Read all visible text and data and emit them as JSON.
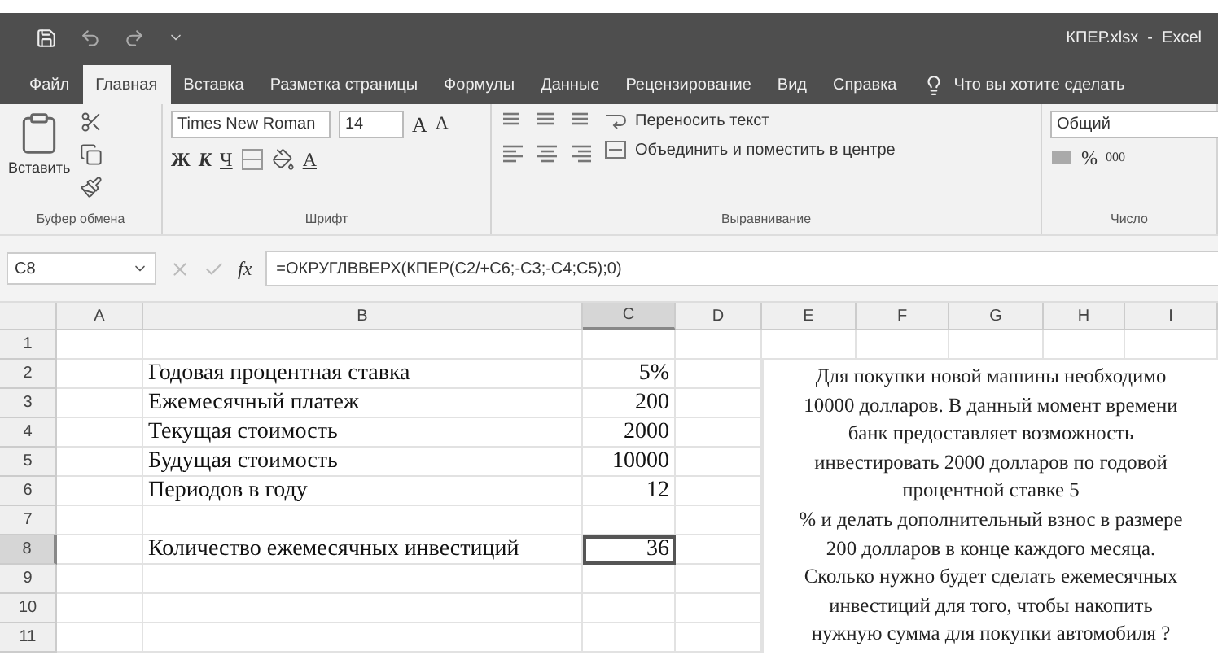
{
  "window": {
    "title": "КПЕР.xlsx  -  Excel"
  },
  "tabs": [
    {
      "label": "Файл",
      "selected": false
    },
    {
      "label": "Главная",
      "selected": true
    },
    {
      "label": "Вставка",
      "selected": false
    },
    {
      "label": "Разметка страницы",
      "selected": false
    },
    {
      "label": "Формулы",
      "selected": false
    },
    {
      "label": "Данные",
      "selected": false
    },
    {
      "label": "Рецензирование",
      "selected": false
    },
    {
      "label": "Вид",
      "selected": false
    },
    {
      "label": "Справка",
      "selected": false
    }
  ],
  "tell_me": {
    "placeholder": "Что вы хотите сделать"
  },
  "ribbon": {
    "clipboard": {
      "paste": "Вставить",
      "group_label": "Буфер обмена"
    },
    "font": {
      "font_name": "Times New Roman",
      "font_size": "14",
      "grow": "A",
      "shrink": "A",
      "bold": "Ж",
      "italic": "К",
      "underline": "Ч",
      "font_color": "A",
      "group_label": "Шрифт"
    },
    "alignment": {
      "wrap": "Переносить текст",
      "merge": "Объединить и поместить в центре",
      "group_label": "Выравнивание"
    },
    "number": {
      "format": "Общий",
      "percent": "%",
      "thousands": "000",
      "group_label": "Число"
    }
  },
  "formula_bar": {
    "name_box": "C8",
    "fx": "fx",
    "formula": "=ОКРУГЛВВЕРХ(КПЕР(C2/+C6;-C3;-C4;C5);0)"
  },
  "sheet": {
    "columns": [
      {
        "label": "A",
        "selected": false
      },
      {
        "label": "B",
        "selected": false
      },
      {
        "label": "C",
        "selected": true
      },
      {
        "label": "D",
        "selected": false
      },
      {
        "label": "E",
        "selected": false
      },
      {
        "label": "F",
        "selected": false
      },
      {
        "label": "G",
        "selected": false
      },
      {
        "label": "H",
        "selected": false
      },
      {
        "label": "I",
        "selected": false
      }
    ],
    "rows": [
      {
        "number": "1",
        "selected": false
      },
      {
        "number": "2",
        "selected": false,
        "label": "Годовая процентная ставка",
        "value": "5%"
      },
      {
        "number": "3",
        "selected": false,
        "label": "Ежемесячный платеж",
        "value": "200"
      },
      {
        "number": "4",
        "selected": false,
        "label": "Текущая стоимость",
        "value": "2000"
      },
      {
        "number": "5",
        "selected": false,
        "label": "Будущая стоимость",
        "value": "10000"
      },
      {
        "number": "6",
        "selected": false,
        "label": "Периодов в году",
        "value": "12"
      },
      {
        "number": "7",
        "selected": false
      },
      {
        "number": "8",
        "selected": true,
        "label": "Количество ежемесячных инвестиций",
        "value": "36"
      },
      {
        "number": "9",
        "selected": false
      },
      {
        "number": "10",
        "selected": false
      },
      {
        "number": "11",
        "selected": false
      }
    ],
    "note": "Для покупки новой машины необходимо\n10000 долларов. В данный момент времени\nбанк предоставляет возможность\nинвестировать 2000 долларов по годовой\nпроцентной ставке 5\n% и делать дополнительный взнос в размере\n200 долларов в конце каждого месяца.\nСколько нужно будет сделать ежемесячных\nинвестиций для того, чтобы накопить\nнужную сумма для покупки автомобиля ?"
  }
}
